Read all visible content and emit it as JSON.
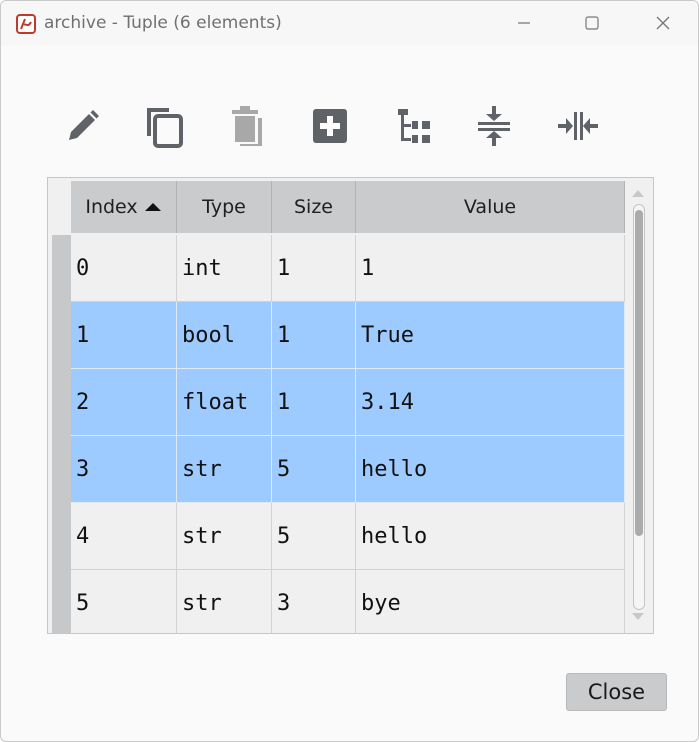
{
  "window": {
    "title": "archive - Tuple (6 elements)",
    "app_icon": "spyder-logo-icon",
    "controls": [
      "minimize-icon",
      "maximize-icon",
      "close-icon"
    ]
  },
  "toolbar": {
    "buttons": [
      {
        "icon": "pencil-icon",
        "action": "edit"
      },
      {
        "icon": "copy-icon",
        "action": "copy"
      },
      {
        "icon": "trash-icon",
        "action": "remove",
        "disabled": true
      },
      {
        "icon": "plus-box-icon",
        "action": "insert"
      },
      {
        "icon": "tree-icon",
        "action": "view"
      },
      {
        "icon": "resize-rows-icon",
        "action": "resize-rows"
      },
      {
        "icon": "resize-columns-icon",
        "action": "resize-columns"
      }
    ]
  },
  "table": {
    "columns": [
      {
        "label": "Index",
        "sort": "ascending"
      },
      {
        "label": "Type"
      },
      {
        "label": "Size"
      },
      {
        "label": "Value"
      }
    ],
    "rows": [
      {
        "index": "0",
        "type": "int",
        "size": "1",
        "value": "1",
        "selected": false
      },
      {
        "index": "1",
        "type": "bool",
        "size": "1",
        "value": "True",
        "selected": true
      },
      {
        "index": "2",
        "type": "float",
        "size": "1",
        "value": "3.14",
        "selected": true
      },
      {
        "index": "3",
        "type": "str",
        "size": "5",
        "value": "hello",
        "selected": true
      },
      {
        "index": "4",
        "type": "str",
        "size": "5",
        "value": "hello",
        "selected": false
      },
      {
        "index": "5",
        "type": "str",
        "size": "3",
        "value": "bye",
        "selected": false
      }
    ]
  },
  "footer": {
    "close_label": "Close"
  },
  "colors": {
    "selection": "#9ecbff",
    "header": "#c9cbcd",
    "icon": "#5f6368",
    "icon_disabled": "#a8a8a8"
  }
}
